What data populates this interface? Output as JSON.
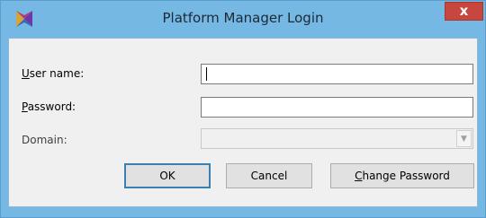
{
  "window": {
    "title": "Platform Manager Login",
    "close_label": "x",
    "icon": "app-logo-icon"
  },
  "form": {
    "username": {
      "accel": "U",
      "rest": "ser name:",
      "value": ""
    },
    "password": {
      "accel": "P",
      "rest": "assword:",
      "value": ""
    },
    "domain": {
      "label": "Domain:",
      "value": "",
      "enabled": false
    }
  },
  "buttons": {
    "ok": "OK",
    "cancel": "Cancel",
    "change_accel": "C",
    "change_rest": "hange Password"
  },
  "colors": {
    "frame": "#74b8e3",
    "close": "#c7463d",
    "client": "#f0f0f0"
  }
}
